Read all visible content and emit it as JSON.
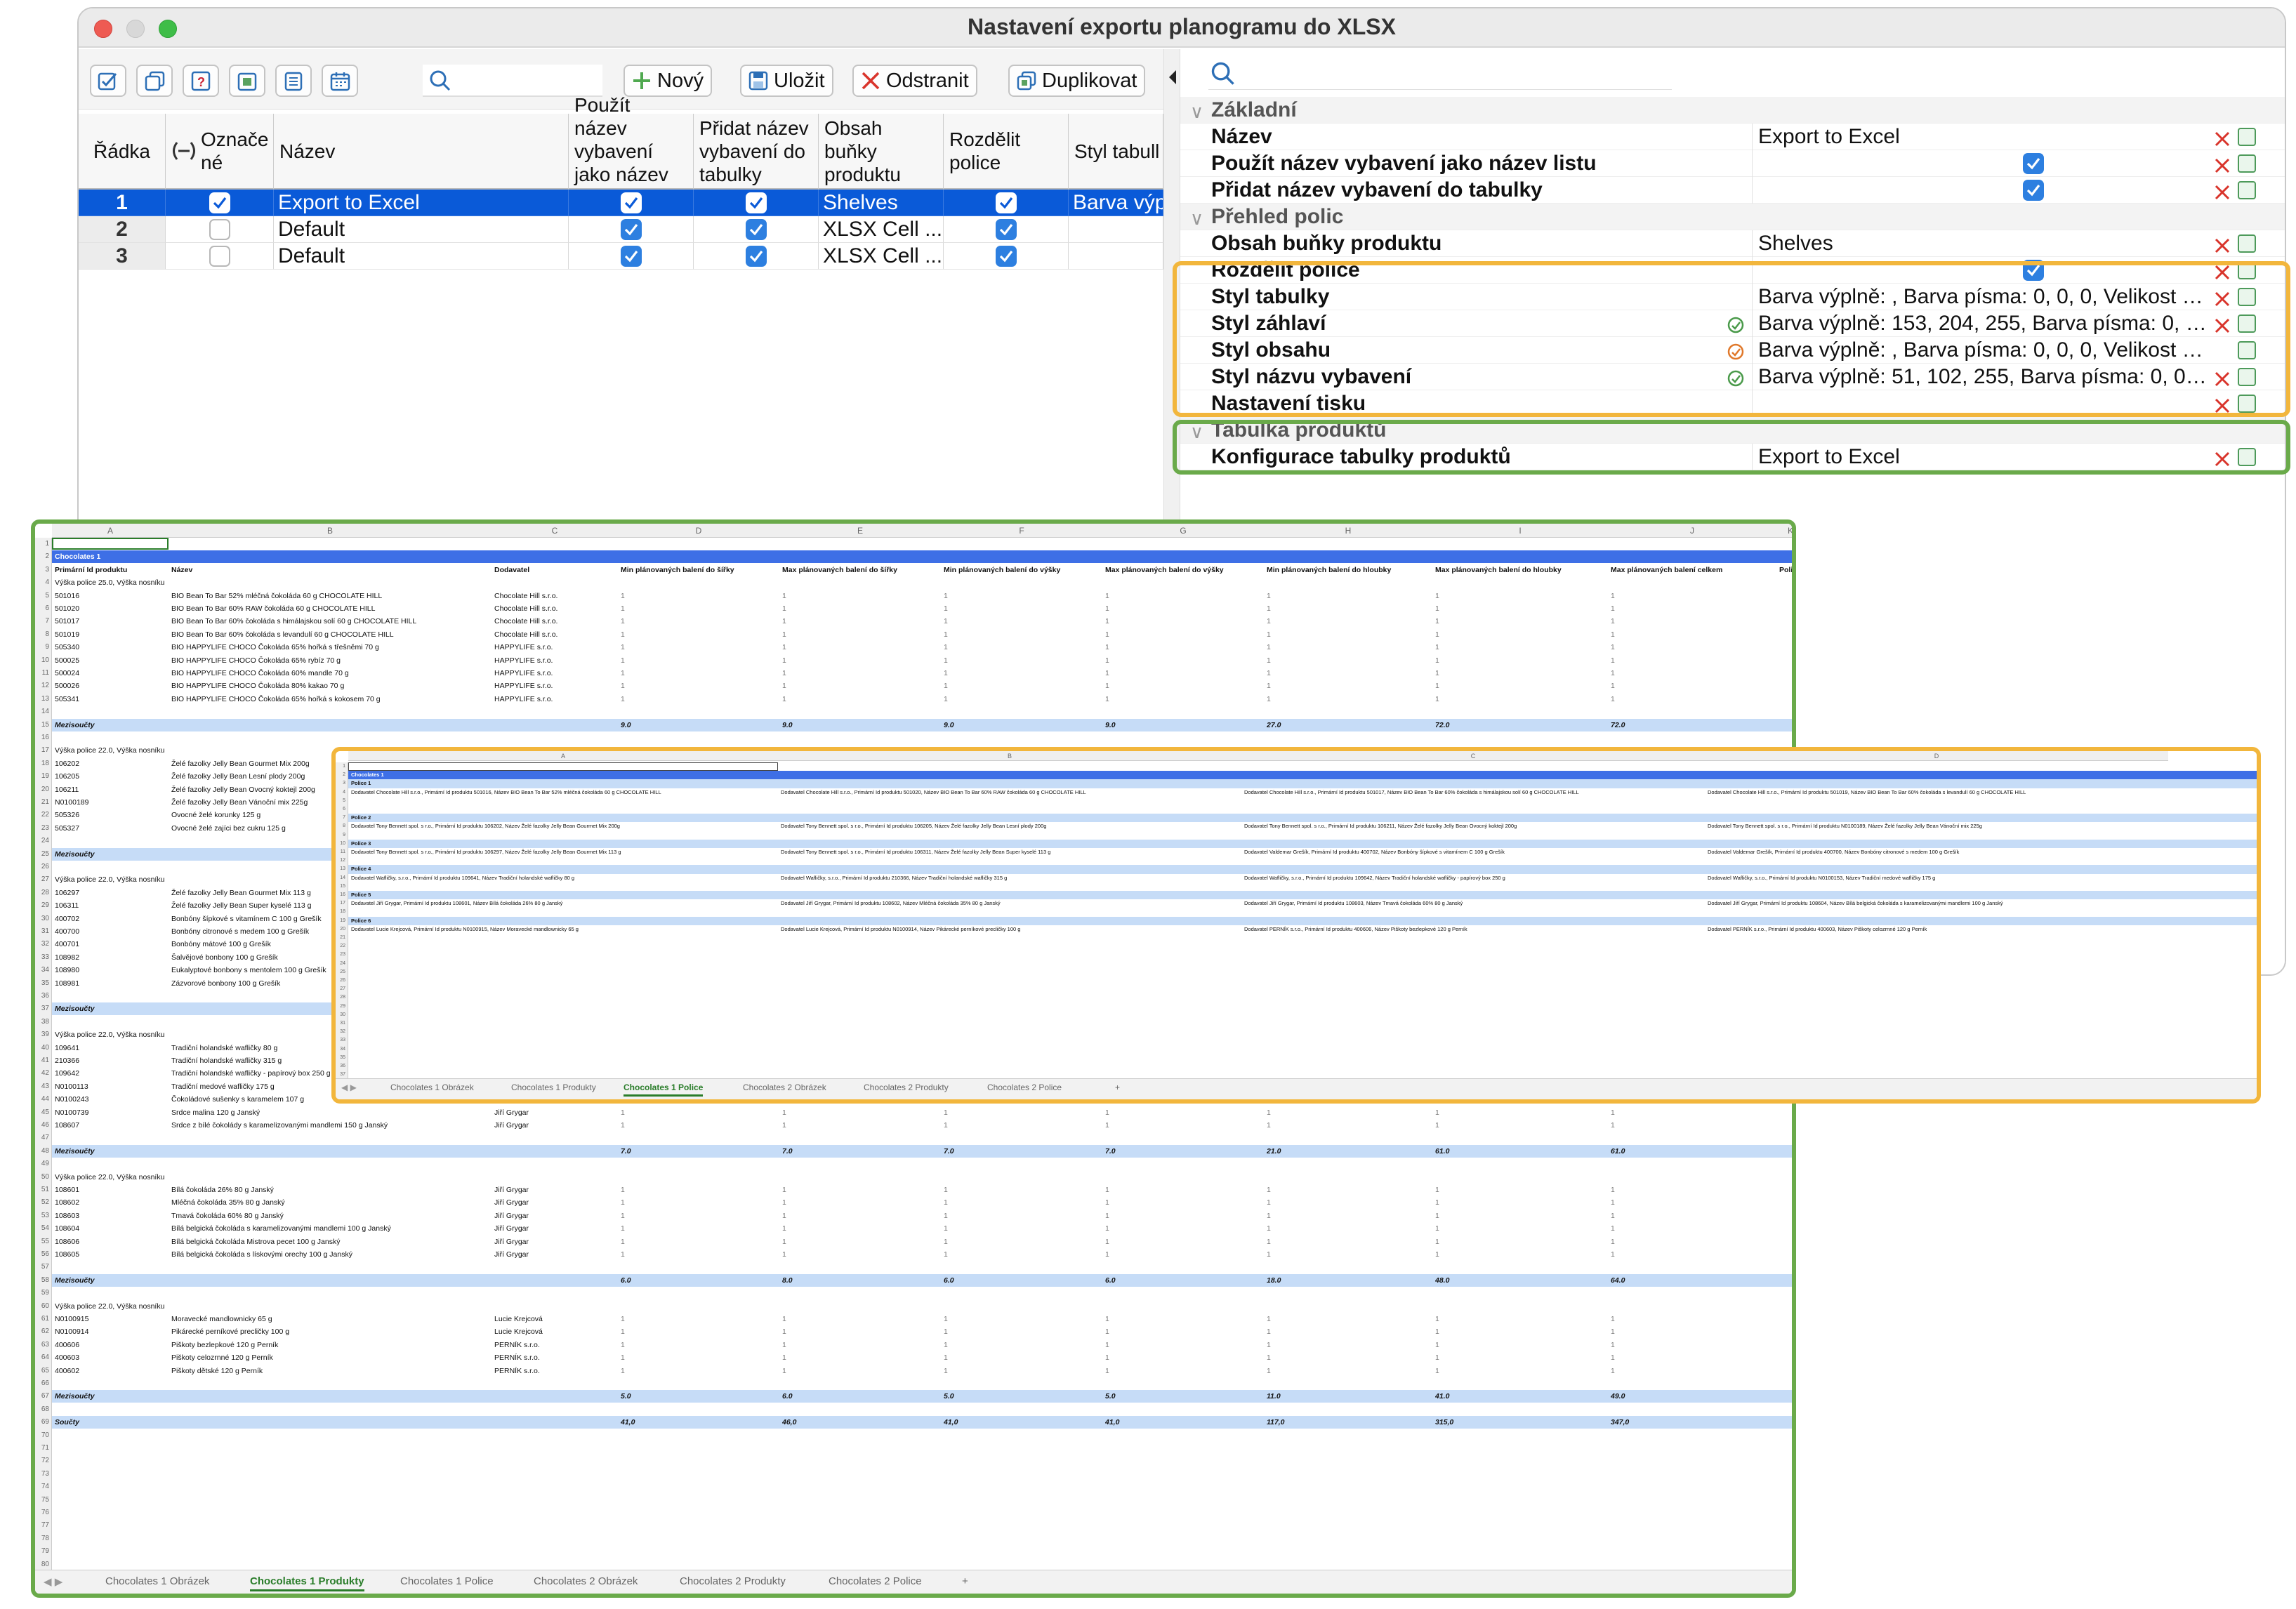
{
  "window": {
    "title": "Nastavení exportu planogramu do XLSX"
  },
  "toolbar": {
    "new_label": "Nový",
    "save_label": "Uložit",
    "delete_label": "Odstranit",
    "duplicate_label": "Duplikovat",
    "search_placeholder": ""
  },
  "table": {
    "headers": [
      "Řádka",
      "Označe né",
      "Název",
      "Použít název vybavení jako název ...",
      "Přidat název vybavení do tabulky",
      "Obsah buňky produktu",
      "Rozdělit police",
      "Styl tabull"
    ],
    "rows": [
      {
        "num": "1",
        "marked": true,
        "name": "Export to Excel",
        "use_name": true,
        "add_name": true,
        "content": "Shelves",
        "split": true,
        "style": "Barva výp",
        "selected": true
      },
      {
        "num": "2",
        "marked": false,
        "name": "Default",
        "use_name": true,
        "add_name": true,
        "content": "XLSX Cell ...",
        "split": true,
        "style": "",
        "selected": false
      },
      {
        "num": "3",
        "marked": false,
        "name": "Default",
        "use_name": true,
        "add_name": true,
        "content": "XLSX Cell ...",
        "split": true,
        "style": "",
        "selected": false
      }
    ]
  },
  "props": {
    "sec1": "Základní",
    "nazev": {
      "name": "Název",
      "value": "Export to Excel"
    },
    "pouzit": {
      "name": "Použít název vybavení jako název listu"
    },
    "pridat": {
      "name": "Přidat název vybavení do tabulky"
    },
    "sec2": "Přehled polic",
    "obsah": {
      "name": "Obsah buňky produktu",
      "value": "Shelves"
    },
    "rozdelit": {
      "name": "Rozdělit police"
    },
    "styl_tab": {
      "name": "Styl tabulky",
      "value": "Barva výplně: , Barva písma: 0, 0, 0, Velikost písma..."
    },
    "styl_zahl": {
      "name": "Styl záhlaví",
      "value": "Barva výplně: 153, 204, 255, Barva písma: 0, 0, 0..."
    },
    "styl_obs": {
      "name": "Styl obsahu",
      "value": "Barva výplně: , Barva písma: 0, 0, 0, Velikost písma..."
    },
    "styl_naz": {
      "name": "Styl názvu vybavení",
      "value": "Barva výplně: 51, 102, 255, Barva písma: 0, 0, 0..."
    },
    "tisk": {
      "name": "Nastavení tisku"
    },
    "sec3": "Tabulka produktů",
    "konfig": {
      "name": "Konfigurace tabulky produktů",
      "value": "Export to Excel"
    }
  },
  "sheet1": {
    "cols": [
      "A",
      "B",
      "C",
      "D",
      "E",
      "F",
      "G",
      "H",
      "I",
      "J",
      "K"
    ],
    "title": "Chocolates 1",
    "header": [
      "Primární Id produktu",
      "Název",
      "Dodavatel",
      "Min plánovaných balení do šířky",
      "Max plánovaných balení do šířky",
      "Min plánovaných balení do výšky",
      "Max plánovaných balení do výšky",
      "Min plánovaných balení do hloubky",
      "Max plánovaných balení do hloubky",
      "Max plánovaných balení celkem",
      "Police v po"
    ],
    "shelf1": "Výška police 25.0, Výška nosníku 1.0",
    "p1": [
      [
        "501016",
        "BIO Bean To Bar 52% mléčná čokoláda 60 g CHOCOLATE HILL",
        "Chocolate Hill s.r.o."
      ],
      [
        "501020",
        "BIO Bean To Bar 60% RAW čokoláda 60 g CHOCOLATE HILL",
        "Chocolate Hill s.r.o."
      ],
      [
        "501017",
        "BIO Bean To Bar 60% čokoláda s himálajskou solí 60 g CHOCOLATE HILL",
        "Chocolate Hill s.r.o."
      ],
      [
        "501019",
        "BIO Bean To Bar 60% čokoláda s levandulí 60 g CHOCOLATE HILL",
        "Chocolate Hill s.r.o."
      ],
      [
        "505340",
        "BIO HAPPYLIFE CHOCO Čokoláda 65% hořká s třešněmi 70 g",
        "HAPPYLIFE s.r.o."
      ],
      [
        "500025",
        "BIO HAPPYLIFE CHOCO Čokoláda 65% rybíz 70 g",
        "HAPPYLIFE s.r.o."
      ],
      [
        "500024",
        "BIO HAPPYLIFE CHOCO Čokoláda 60% mandle 70 g",
        "HAPPYLIFE s.r.o."
      ],
      [
        "500026",
        "BIO HAPPYLIFE CHOCO Čokoláda 80% kakao 70 g",
        "HAPPYLIFE s.r.o."
      ],
      [
        "505341",
        "BIO HAPPYLIFE CHOCO Čokoláda 65% hořká s kokosem 70 g",
        "HAPPYLIFE s.r.o."
      ]
    ],
    "sum_label": "Mezisoučty",
    "sum1": [
      "9.0",
      "9.0",
      "9.0",
      "9.0",
      "27.0",
      "72.0",
      "72.0"
    ],
    "shelf2": "Výška police 22.0, Výška nosníku 1.0",
    "p2": [
      [
        "106202",
        "Želé fazolky Jelly Bean Gourmet Mix 200g"
      ],
      [
        "106205",
        "Želé fazolky Jelly Bean Lesní plody 200g"
      ],
      [
        "106211",
        "Želé fazolky Jelly Bean Ovocný koktejl 200g"
      ],
      [
        "N0100189",
        "Želé fazolky Jelly Bean Vánoční mix 225g"
      ],
      [
        "505326",
        "Ovocné želé korunky 125 g"
      ],
      [
        "505327",
        "Ovocné želé zajíci bez cukru 125 g"
      ]
    ],
    "shelf3": "Výška police 22.0, Výška nosníku 1.0",
    "p3": [
      [
        "106297",
        "Želé fazolky Jelly Bean Gourmet Mix 113 g"
      ],
      [
        "106311",
        "Želé fazolky Jelly Bean Super kyselé 113 g"
      ],
      [
        "400702",
        "Bonbóny šípkové s vitamínem C 100 g Grešík"
      ],
      [
        "400700",
        "Bonbóny citronové s medem 100 g Grešík"
      ],
      [
        "400701",
        "Bonbóny mátové 100 g Grešík"
      ],
      [
        "108982",
        "Šalvějové bonbony 100 g Grešík"
      ],
      [
        "108980",
        "Eukalyptové bonbony s mentolem 100 g Grešík"
      ],
      [
        "108981",
        "Zázvorové bonbony 100 g Grešík"
      ]
    ],
    "shelf4": "Výška police 22.0, Výška nosníku 1.0",
    "p4": [
      [
        "109641",
        "Tradiční holandské wafličky 80 g",
        ""
      ],
      [
        "210366",
        "Tradiční holandské wafličky 315 g",
        ""
      ],
      [
        "109642",
        "Tradiční holandské wafličky - papírový box 250 g",
        ""
      ],
      [
        "N0100113",
        "Tradiční medové wafličky 175 g",
        ""
      ],
      [
        "N0100243",
        "Čokoládové sušenky s karamelem 107 g",
        "Wafličky, s.r.o."
      ],
      [
        "N0100739",
        "Srdce malina 120 g Janský",
        "Jiří Grygar"
      ],
      [
        "108607",
        "Srdce z bílé čokolády s karamelizovanými mandlemi 150 g Janský",
        "Jiří Grygar"
      ]
    ],
    "sum4": [
      "7.0",
      "7.0",
      "7.0",
      "7.0",
      "21.0",
      "61.0",
      "61.0"
    ],
    "shelf5": "Výška police 22.0, Výška nosníku 1.0",
    "p5": [
      [
        "108601",
        "Bílá čokoláda 26% 80 g Janský",
        "Jiří Grygar"
      ],
      [
        "108602",
        "Mléčná čokoláda 35% 80 g Janský",
        "Jiří Grygar"
      ],
      [
        "108603",
        "Tmavá čokoláda 60% 80 g Janský",
        "Jiří Grygar"
      ],
      [
        "108604",
        "Bílá belgická čokoláda s karamelizovanými mandlemi 100 g Janský",
        "Jiří Grygar"
      ],
      [
        "108606",
        "Bílá belgická čokoláda Mistrova pecet 100 g Janský",
        "Jiří Grygar"
      ],
      [
        "108605",
        "Bílá belgická čokoláda s lískovými orechy 100 g Janský",
        "Jiří Grygar"
      ]
    ],
    "sum5": [
      "6.0",
      "8.0",
      "6.0",
      "6.0",
      "18.0",
      "48.0",
      "64.0"
    ],
    "shelf6": "Výška police 22.0, Výška nosníku 1.0",
    "p6": [
      [
        "N0100915",
        "Moravecké mandlownicky 65 g",
        "Lucie Krejcová"
      ],
      [
        "N0100914",
        "Pikárecké perníkové precličky 100 g",
        "Lucie Krejcová"
      ],
      [
        "400606",
        "Piškoty bezlepkové 120 g Perník",
        "PERNÍK s.r.o."
      ],
      [
        "400603",
        "Piškoty celozrnné 120 g Perník",
        "PERNÍK s.r.o."
      ],
      [
        "400602",
        "Piškoty dětské 120 g Perník",
        "PERNÍK s.r.o."
      ]
    ],
    "sum6": [
      "5.0",
      "6.0",
      "5.0",
      "5.0",
      "11.0",
      "41.0",
      "49.0"
    ],
    "total_label": "Součty",
    "total": [
      "41,0",
      "46,0",
      "41,0",
      "41,0",
      "117,0",
      "315,0",
      "347,0"
    ],
    "tabs": [
      "Chocolates 1 Obrázek",
      "Chocolates 1 Produkty",
      "Chocolates 1 Police",
      "Chocolates 2 Obrázek",
      "Chocolates 2 Produkty",
      "Chocolates 2 Police",
      "+"
    ]
  },
  "sheet2": {
    "cols": [
      "A",
      "B",
      "C",
      "D"
    ],
    "title": "Chocolates 1",
    "shelves": [
      {
        "label": "Police 1",
        "cells": [
          "Dodavatel Chocolate Hill s.r.o., Primární Id produktu 501016, Název BIO Bean To Bar 52% mléčná čokoláda 60 g CHOCOLATE HILL",
          "Dodavatel Chocolate Hill s.r.o., Primární Id produktu 501020, Název BIO Bean To Bar 60% RAW čokoláda 60 g CHOCOLATE HILL",
          "Dodavatel Chocolate Hill s.r.o., Primární Id produktu 501017, Název BIO Bean To Bar 60% čokoláda s himálajskou solí 60 g CHOCOLATE HILL",
          "Dodavatel Chocolate Hill s.r.o., Primární Id produktu 501019, Název BIO Bean To Bar 60% čokoláda s levandulí 60 g CHOCOLATE HILL"
        ]
      },
      {
        "label": "Police 2",
        "cells": [
          "Dodavatel Tony Bennett spol. s r.o., Primární Id produktu 106202, Název Želé fazolky Jelly Bean Gourmet Mix 200g",
          "Dodavatel Tony Bennett spol. s r.o., Primární Id produktu 106205, Název Želé fazolky Jelly Bean Lesní plody 200g",
          "Dodavatel Tony Bennett spol. s r.o., Primární Id produktu 106211, Název Želé fazolky Jelly Bean Ovocný koktejl 200g",
          "Dodavatel Tony Bennett spol. s r.o., Primární Id produktu N0100189, Název Želé fazolky Jelly Bean Vánoční mix 225g"
        ]
      },
      {
        "label": "Police 3",
        "cells": [
          "Dodavatel Tony Bennett spol. s r.o., Primární Id produktu 106297, Název Želé fazolky Jelly Bean Gourmet Mix 113 g",
          "Dodavatel Tony Bennett spol. s r.o., Primární Id produktu 106311, Název Želé fazolky Jelly Bean Super kyselé 113 g",
          "Dodavatel Valdemar Grešík, Primární Id produktu 400702, Název Bonbóny šípkové s vitamínem C 100 g Grešík",
          "Dodavatel Valdemar Grešík, Primární Id produktu 400700, Název Bonbóny citronové s medem 100 g Grešík"
        ]
      },
      {
        "label": "Police 4",
        "cells": [
          "Dodavatel Wafličky, s.r.o., Primární Id produktu 109641, Název Tradiční holandské wafličky 80 g",
          "Dodavatel Wafličky, s.r.o., Primární Id produktu 210366, Název Tradiční holandské wafličky 315 g",
          "Dodavatel Wafličky, s.r.o., Primární Id produktu 109642, Název Tradiční holandské wafličky - papírový box 250 g",
          "Dodavatel Wafličky, s.r.o., Primární Id produktu N0100153, Název Tradiční medové wafličky 175 g"
        ]
      },
      {
        "label": "Police 5",
        "cells": [
          "Dodavatel Jiří Grygar, Primární Id produktu 108601, Název Bílá čokoláda 26% 80 g Janský",
          "Dodavatel Jiří Grygar, Primární Id produktu 108602, Název Mléčná čokoláda 35% 80 g Janský",
          "Dodavatel Jiří Grygar, Primární Id produktu 108603, Název Tmavá čokoláda 60% 80 g Janský",
          "Dodavatel Jiří Grygar, Primární Id produktu 108604, Název Bílá belgická čokoláda s karamelizovanými mandlemi 100 g Janský"
        ]
      },
      {
        "label": "Police 6",
        "cells": [
          "Dodavatel Lucie Krejcová, Primární Id produktu N0100915, Název Moravecké mandlownicky 65 g",
          "Dodavatel Lucie Krejcová, Primární Id produktu N0100914, Název Pikárecké perníkové precličky 100 g",
          "Dodavatel PERNÍK s.r.o., Primární Id produktu 400606, Název Piškoty bezlepkové 120 g Perník",
          "Dodavatel PERNÍK s.r.o., Primární Id produktu 400603, Název Piškoty celozrnné 120 g Perník"
        ]
      }
    ],
    "tabs": [
      "Chocolates 1 Obrázek",
      "Chocolates 1 Produkty",
      "Chocolates 1 Police",
      "Chocolates 2 Obrázek",
      "Chocolates 2 Produkty",
      "Chocolates 2 Police",
      "+"
    ]
  },
  "colors": {
    "accent": "#2d7fe0",
    "selection": "#0a5ad8",
    "highlight_orange": "#f2b63c",
    "highlight_green": "#6aaa4a",
    "title_band": "#3e6fe6",
    "sum_band": "#c6dcf7"
  }
}
